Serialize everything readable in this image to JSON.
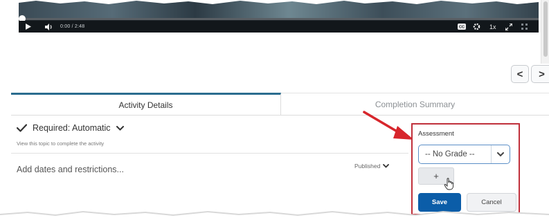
{
  "player": {
    "time": "0:00 / 2:48",
    "speed": "1x",
    "progress_fraction": 0.0,
    "icons": [
      "play-icon",
      "volume-icon",
      "captions-icon",
      "gear-icon",
      "fullscreen-icon",
      "grid-icon"
    ]
  },
  "navigation": {
    "prev_label": "<",
    "next_label": ">"
  },
  "tabs": [
    {
      "label": "Activity Details",
      "active": true
    },
    {
      "label": "Completion Summary",
      "active": false
    }
  ],
  "details": {
    "required_label": "Required: Automatic",
    "required_help": "View this topic to complete the activity",
    "add_dates_label": "Add dates and restrictions...",
    "published_label": "Published"
  },
  "assessment": {
    "label": "Assessment",
    "grade_value": "-- No Grade --",
    "add_label": "+",
    "save_label": "Save",
    "cancel_label": "Cancel"
  },
  "colors": {
    "accent_tab": "#2b6d8f",
    "primary_button": "#0b5da8",
    "annotation_red": "#c0303b"
  }
}
